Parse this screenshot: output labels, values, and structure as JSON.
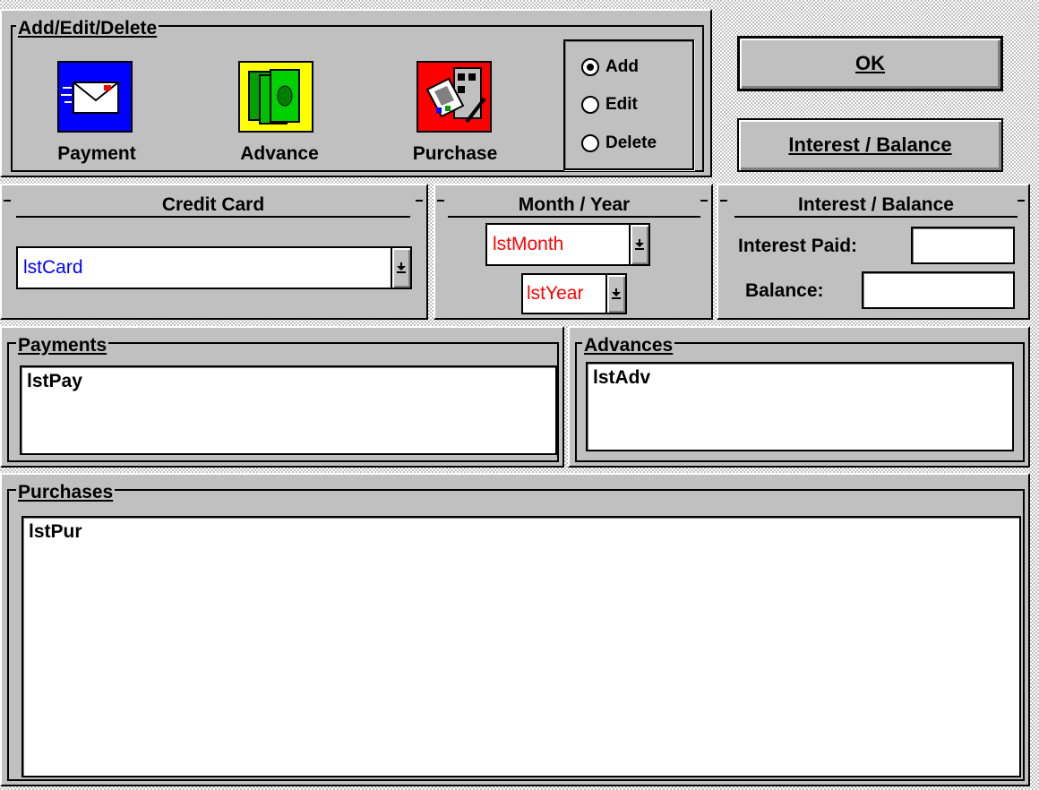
{
  "add_edit_delete": {
    "legend": "Add/Edit/Delete",
    "icons": [
      {
        "label": "Payment",
        "icon": "payment-envelope-icon",
        "bg": "#0000ff"
      },
      {
        "label": "Advance",
        "icon": "money-advance-icon",
        "bg": "#ffff00"
      },
      {
        "label": "Purchase",
        "icon": "purchase-terminal-icon",
        "bg": "#ff0000"
      }
    ],
    "modes": [
      {
        "label": "Add",
        "checked": true
      },
      {
        "label": "Edit",
        "checked": false
      },
      {
        "label": "Delete",
        "checked": false
      }
    ]
  },
  "buttons": {
    "ok": "OK",
    "interest_balance": "Interest / Balance"
  },
  "credit_card": {
    "legend": "Credit Card",
    "value": "lstCard",
    "value_color": "#0000ff"
  },
  "month_year": {
    "legend": "Month / Year",
    "month": "lstMonth",
    "year": "lstYear",
    "value_color": "#ff0000"
  },
  "interest_balance": {
    "legend": "Interest / Balance",
    "interest_paid_label": "Interest Paid:",
    "balance_label": "Balance:",
    "interest_paid_value": "",
    "balance_value": ""
  },
  "payments": {
    "legend": "Payments",
    "list_text": "lstPay"
  },
  "advances": {
    "legend": "Advances",
    "list_text": "lstAdv"
  },
  "purchases": {
    "legend": "Purchases",
    "list_text": "lstPur"
  }
}
